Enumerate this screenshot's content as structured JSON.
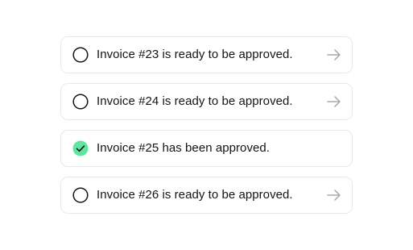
{
  "invoices": [
    {
      "text": "Invoice #23 is ready to be approved.",
      "status": "pending",
      "icon": "empty-circle-icon",
      "action_icon": "arrow-right-icon"
    },
    {
      "text": "Invoice #24 is ready to be approved.",
      "status": "pending",
      "icon": "empty-circle-icon",
      "action_icon": "arrow-right-icon"
    },
    {
      "text": "Invoice #25 has been approved.",
      "status": "approved",
      "icon": "check-circle-icon"
    },
    {
      "text": "Invoice #26 is ready to be approved.",
      "status": "pending",
      "icon": "empty-circle-icon",
      "action_icon": "arrow-right-icon"
    }
  ],
  "colors": {
    "approved_fill": "#5ee6a0",
    "check_mark": "#141414",
    "circle_outline": "#141414",
    "arrow": "#a8a8a8",
    "card_border": "#e9e9e9",
    "text": "#141414"
  }
}
